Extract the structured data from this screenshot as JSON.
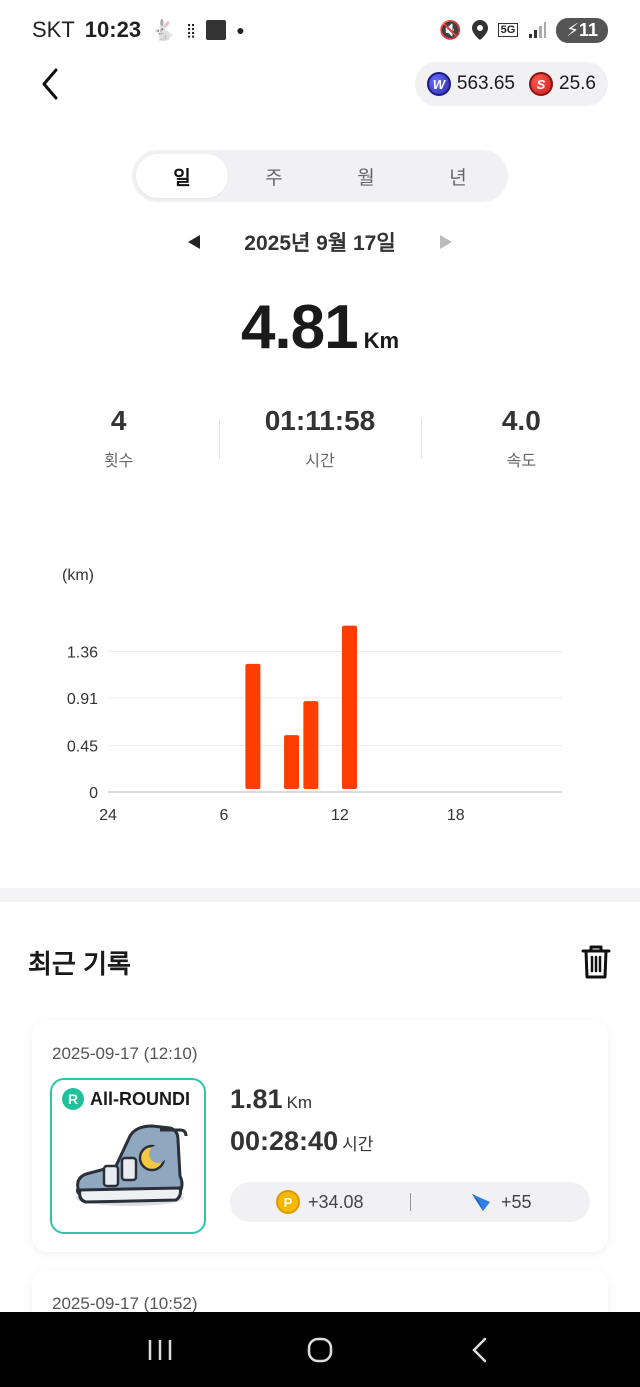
{
  "status": {
    "carrier": "SKT",
    "time": "10:23",
    "battery": "11",
    "network": "5G"
  },
  "wallet": {
    "token_w_value": "563.65",
    "token_s_value": "25.6"
  },
  "period_tabs": [
    "일",
    "주",
    "월",
    "년"
  ],
  "active_tab": 0,
  "date_label": "2025년 9월 17일",
  "summary": {
    "distance": "4.81",
    "distance_unit": "Km",
    "count_value": "4",
    "count_label": "횟수",
    "time_value": "01:11:58",
    "time_label": "시간",
    "speed_value": "4.0",
    "speed_label": "속도"
  },
  "chart_data": {
    "type": "bar",
    "ylabel": "(km)",
    "yticks": [
      "1.36",
      "0.91",
      "0.45",
      "0"
    ],
    "ylim": [
      0,
      1.81
    ],
    "xticks": [
      "24",
      "6",
      "12",
      "18"
    ],
    "xlim": [
      0,
      24
    ],
    "bar_color": "#ff3d00",
    "grid": true,
    "bars": [
      {
        "hour": 7,
        "value": 1.24
      },
      {
        "hour": 9,
        "value": 0.55
      },
      {
        "hour": 10,
        "value": 0.88
      },
      {
        "hour": 12,
        "value": 1.61
      }
    ]
  },
  "recent": {
    "title": "최근 기록",
    "records": [
      {
        "timestamp": "2025-09-17 (12:10)",
        "shoe_badge": "R",
        "shoe_name": "All-ROUNDI",
        "distance": "1.81",
        "distance_unit": "Km",
        "time": "00:28:40",
        "time_unit": "시간",
        "reward_coin": "P",
        "reward_points": "+34.08",
        "reward_xp": "+55"
      },
      {
        "timestamp": "2025-09-17 (10:52)"
      }
    ]
  },
  "colors": {
    "accent_bar": "#ff3d00",
    "shoe_border": "#2fc5a8",
    "pill_bg": "#f1f1f4"
  }
}
